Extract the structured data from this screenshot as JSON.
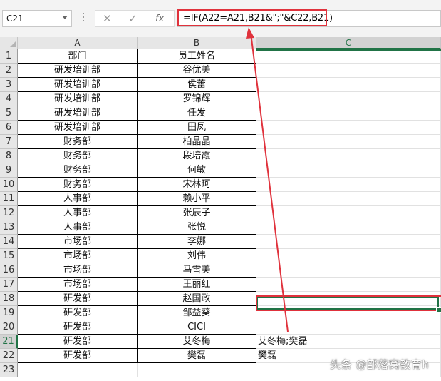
{
  "formula_bar": {
    "name_box": "C21",
    "cancel_glyph": "✕",
    "enter_glyph": "✓",
    "fx_label": "fx",
    "formula": "=IF(A22=A21,B21&\";\"&C22,B21)"
  },
  "columns": [
    "A",
    "B",
    "C"
  ],
  "rows": [
    {
      "n": "1",
      "a": "部门",
      "b": "员工姓名",
      "c": ""
    },
    {
      "n": "2",
      "a": "研发培训部",
      "b": "谷优美",
      "c": ""
    },
    {
      "n": "3",
      "a": "研发培训部",
      "b": "侯蕾",
      "c": ""
    },
    {
      "n": "4",
      "a": "研发培训部",
      "b": "罗锦辉",
      "c": ""
    },
    {
      "n": "5",
      "a": "研发培训部",
      "b": "任发",
      "c": ""
    },
    {
      "n": "6",
      "a": "研发培训部",
      "b": "田凤",
      "c": ""
    },
    {
      "n": "7",
      "a": "财务部",
      "b": "柏晶晶",
      "c": ""
    },
    {
      "n": "8",
      "a": "财务部",
      "b": "段培霞",
      "c": ""
    },
    {
      "n": "9",
      "a": "财务部",
      "b": "何敏",
      "c": ""
    },
    {
      "n": "10",
      "a": "财务部",
      "b": "宋林珂",
      "c": ""
    },
    {
      "n": "11",
      "a": "人事部",
      "b": "赖小平",
      "c": ""
    },
    {
      "n": "12",
      "a": "人事部",
      "b": "张辰子",
      "c": ""
    },
    {
      "n": "13",
      "a": "人事部",
      "b": "张悦",
      "c": ""
    },
    {
      "n": "14",
      "a": "市场部",
      "b": "李娜",
      "c": ""
    },
    {
      "n": "15",
      "a": "市场部",
      "b": "刘伟",
      "c": ""
    },
    {
      "n": "16",
      "a": "市场部",
      "b": "马雪美",
      "c": ""
    },
    {
      "n": "17",
      "a": "市场部",
      "b": "王丽红",
      "c": ""
    },
    {
      "n": "18",
      "a": "研发部",
      "b": "赵国政",
      "c": ""
    },
    {
      "n": "19",
      "a": "研发部",
      "b": "邹益葵",
      "c": ""
    },
    {
      "n": "20",
      "a": "研发部",
      "b": "CICI",
      "c": ""
    },
    {
      "n": "21",
      "a": "研发部",
      "b": "艾冬梅",
      "c": "艾冬梅;樊磊"
    },
    {
      "n": "22",
      "a": "研发部",
      "b": "樊磊",
      "c": "樊磊"
    },
    {
      "n": "23",
      "a": "",
      "b": "",
      "c": ""
    }
  ],
  "watermark": "头条 @部落窝教育h",
  "colors": {
    "annotation": "#e0323c",
    "excel_green": "#217346"
  }
}
